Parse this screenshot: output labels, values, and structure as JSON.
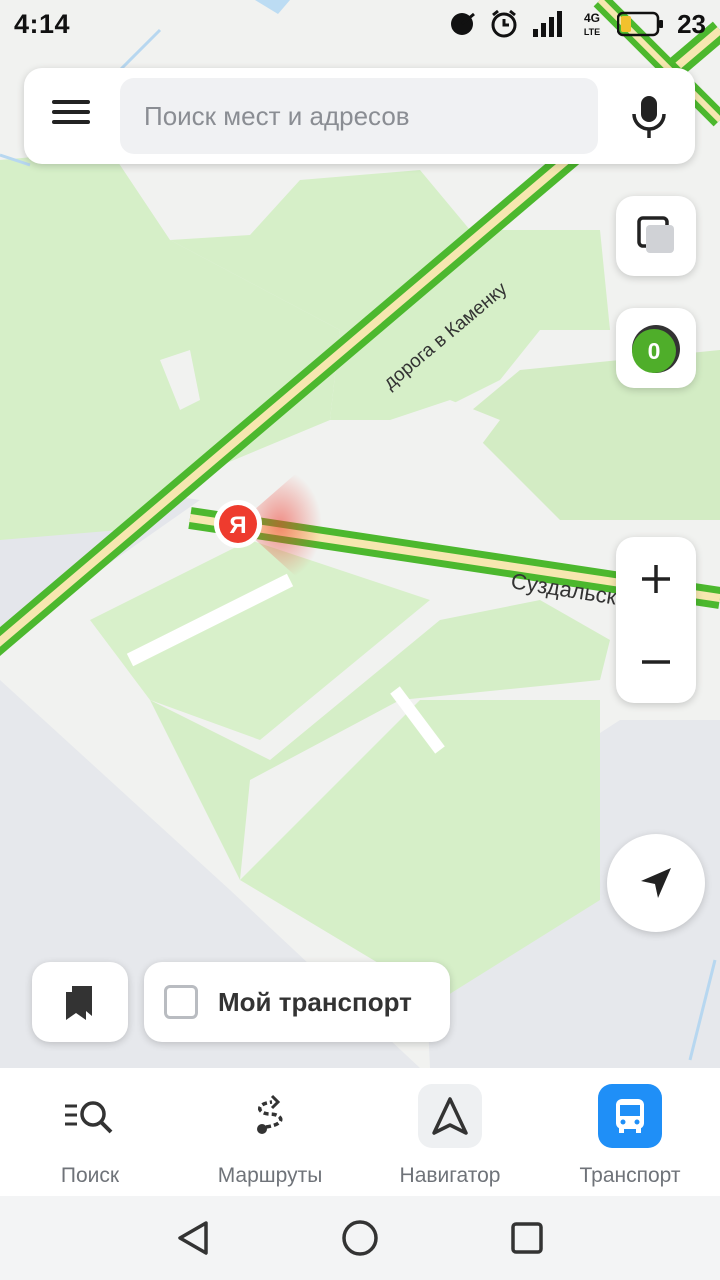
{
  "status_bar": {
    "time": "4:14",
    "network": "4G LTE",
    "battery": "23"
  },
  "search": {
    "placeholder": "Поиск мест и адресов"
  },
  "map": {
    "road_labels": [
      "дорога в Каменку",
      "Суздальское ш"
    ],
    "traffic_level": "0",
    "zoom_in_symbol": "+",
    "zoom_out_symbol": "−",
    "marker_letter": "Я",
    "colors": {
      "forest": "#d6efc8",
      "urban": "#e4e6eb",
      "road_green": "#4cb82e",
      "road_core": "#f6e7b0",
      "marker": "#ee3b2e"
    }
  },
  "map_controls": {
    "transport_label": "Мой транспорт"
  },
  "bottom_nav": {
    "items": [
      {
        "label": "Поиск",
        "icon": "search-list-icon"
      },
      {
        "label": "Маршруты",
        "icon": "route-icon"
      },
      {
        "label": "Навигатор",
        "icon": "navigator-arrow-icon"
      },
      {
        "label": "Транспорт",
        "icon": "bus-icon",
        "active": true
      }
    ]
  },
  "accent_color": "#1f8ff7"
}
